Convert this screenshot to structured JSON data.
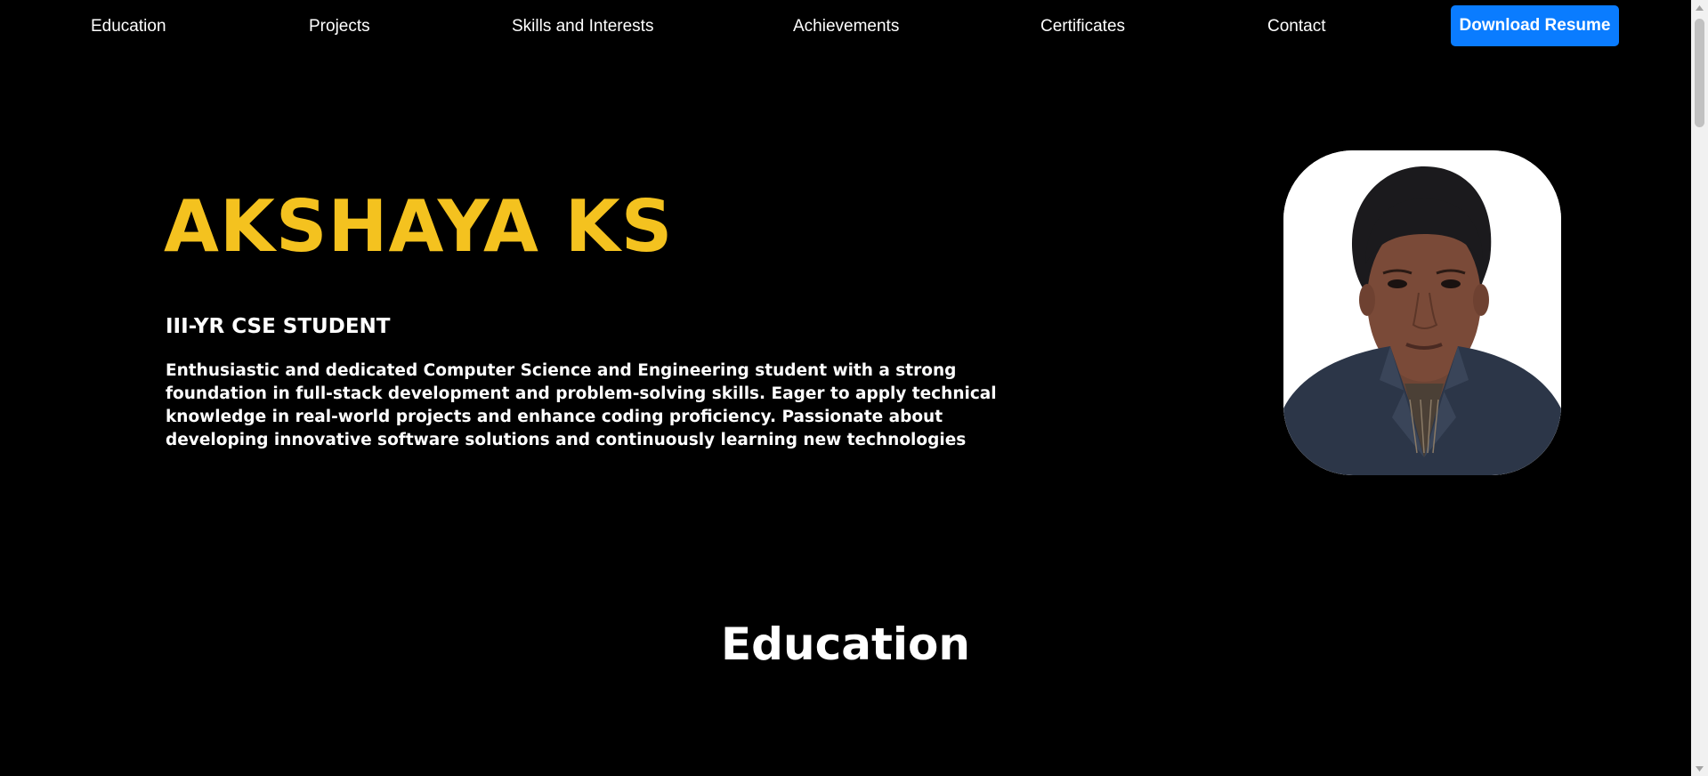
{
  "nav": {
    "links": [
      {
        "label": "Education"
      },
      {
        "label": "Projects"
      },
      {
        "label": "Skills and Interests"
      },
      {
        "label": "Achievements"
      },
      {
        "label": "Certificates"
      },
      {
        "label": "Contact"
      }
    ],
    "download_label": "Download Resume"
  },
  "hero": {
    "name": "AKSHAYA KS",
    "role": "III-YR CSE STUDENT",
    "summary": "Enthusiastic and dedicated Computer Science and Engineering student with a strong foundation in full-stack development and problem-solving skills. Eager to apply technical knowledge in real-world projects and enhance coding proficiency. Passionate about developing innovative software solutions and continuously learning new technologies"
  },
  "section": {
    "heading": "Education"
  },
  "colors": {
    "background": "#000000",
    "accent_name": "#f4c21f",
    "button": "#0a7cff",
    "text": "#ffffff"
  }
}
